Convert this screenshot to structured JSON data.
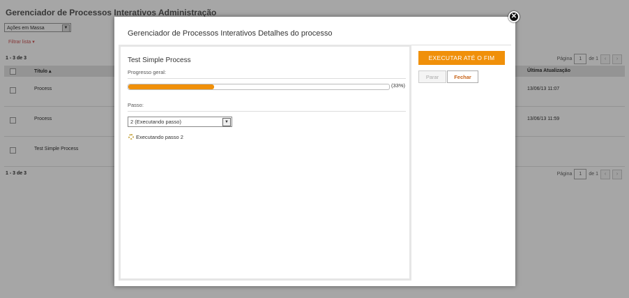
{
  "page": {
    "title": "Gerenciador de Processos Interativos Administração",
    "bulk_actions_label": "Ações em Massa",
    "filter_label": "Filtrar lista ▾",
    "count_top": "1 - 3 de 3",
    "count_bottom": "1 - 3 de 3",
    "pager": {
      "page_label": "Página",
      "page_value": "1",
      "of_label": "de 1",
      "prev": "‹",
      "next": "›"
    },
    "columns": {
      "title": "Título ▴",
      "updated": "Última Atualização"
    },
    "rows": [
      {
        "name": "Process",
        "date": "13/06/13 11:07"
      },
      {
        "name": "Process",
        "date": "13/06/13 11:59"
      },
      {
        "name": "Test Simple Process",
        "date": ""
      }
    ]
  },
  "modal": {
    "title": "Gerenciador de Processos Interativos Detalhes do processo",
    "close_icon": "✕",
    "process_name": "Test Simple Process",
    "progress_label": "Progresso geral:",
    "progress_value": 0.33,
    "progress_text": "(33%)",
    "step_label": "Passo:",
    "step_selected": "2 (Executando passo)",
    "running_text": "Executando passo 2",
    "run_to_end_label": "EXECUTAR ATÉ O FIM",
    "stop_label": "Parar",
    "close_label": "Fechar",
    "colors": {
      "accent": "#f0900a"
    }
  }
}
